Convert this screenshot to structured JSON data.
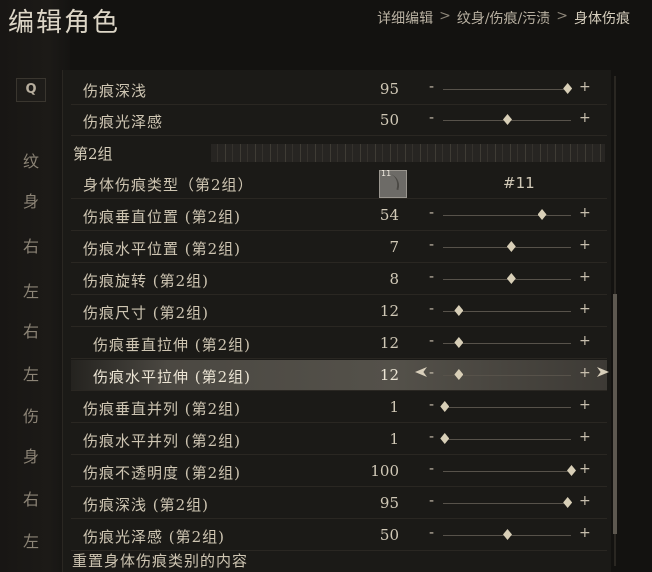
{
  "header": {
    "title": "编辑角色",
    "breadcrumb": [
      "详细编辑",
      "纹身/伤痕/污渍",
      "身体伤痕"
    ],
    "separator": ">"
  },
  "leftnav": {
    "search_label": "Q",
    "items": [
      "纹",
      "身",
      "右",
      "左",
      "右",
      "左",
      "伤",
      "身",
      "右",
      "左"
    ]
  },
  "rows_top": [
    {
      "label": "伤痕深浅",
      "value": "95",
      "fraction": 0.97
    },
    {
      "label": "伤痕光泽感",
      "value": "50",
      "fraction": 0.5
    }
  ],
  "group2": {
    "label": "第2组",
    "type_row": {
      "label": "身体伤痕类型（第2组）",
      "swatch_number": "11",
      "id_text": "#11"
    },
    "rows": [
      {
        "label": "伤痕垂直位置 (第2组)",
        "value": "54",
        "fraction": 0.77
      },
      {
        "label": "伤痕水平位置 (第2组)",
        "value": "7",
        "fraction": 0.53
      },
      {
        "label": "伤痕旋转 (第2组)",
        "value": "8",
        "fraction": 0.53
      },
      {
        "label": "伤痕尺寸 (第2组)",
        "value": "12",
        "fraction": 0.12
      },
      {
        "label": "伤痕垂直拉伸 (第2组)",
        "value": "12",
        "fraction": 0.12,
        "indent": true
      },
      {
        "label": "伤痕水平拉伸 (第2组)",
        "value": "12",
        "fraction": 0.12,
        "indent": true,
        "selected": true
      },
      {
        "label": "伤痕垂直并列 (第2组)",
        "value": "1",
        "fraction": 0.01
      },
      {
        "label": "伤痕水平并列 (第2组)",
        "value": "1",
        "fraction": 0.01
      },
      {
        "label": "伤痕不透明度 (第2组)",
        "value": "100",
        "fraction": 1.0
      },
      {
        "label": "伤痕深浅 (第2组)",
        "value": "95",
        "fraction": 0.97
      },
      {
        "label": "伤痕光泽感 (第2组)",
        "value": "50",
        "fraction": 0.5
      }
    ]
  },
  "controls": {
    "minus": "-",
    "plus": "+"
  },
  "footer": {
    "text": "重置身体伤痕类别的内容"
  },
  "colors": {
    "background": "#131210",
    "panel": "#1b1a17",
    "knob": "#d8cfb7",
    "selected_row": "#54514a"
  }
}
